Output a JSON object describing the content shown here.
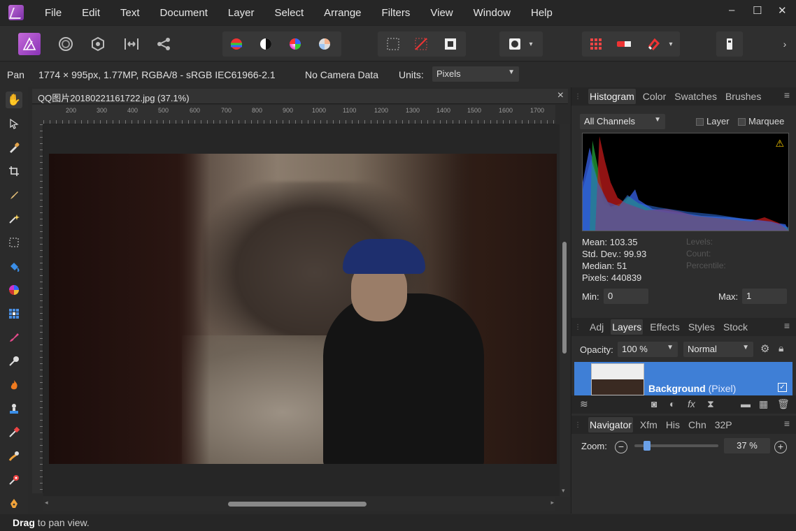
{
  "menu": {
    "items": [
      "File",
      "Edit",
      "Text",
      "Document",
      "Layer",
      "Select",
      "Arrange",
      "Filters",
      "View",
      "Window",
      "Help"
    ],
    "window_controls": [
      "–",
      "☐",
      "✕"
    ]
  },
  "toolbar": {
    "icons": [
      "persona-photo-icon",
      "persona-liquify-icon",
      "persona-develop-icon",
      "persona-tonemap-icon",
      "persona-export-icon",
      "auto-levels-icon",
      "auto-contrast-icon",
      "auto-colors-icon",
      "auto-white-balance-icon",
      "marquee-icon",
      "deselect-icon",
      "invert-selection-icon",
      "quickmask-icon",
      "snapping-grid-icon",
      "snapping-toggle-icon",
      "snapping-magnet-icon",
      "assistant-icon",
      "more-icon"
    ]
  },
  "context": {
    "tool": "Pan",
    "doc_info": "1774 × 995px, 1.77MP, RGBA/8 - sRGB IEC61966-2.1",
    "camera": "No Camera Data",
    "units_label": "Units:",
    "units_value": "Pixels"
  },
  "document": {
    "tab_title": "QQ图片20180221161722.jpg (37.1%)",
    "close": "×",
    "ruler_h": [
      "200",
      "300",
      "400",
      "500",
      "600",
      "700",
      "800",
      "900",
      "1000",
      "1100",
      "1200",
      "1300",
      "1400",
      "1500",
      "1600",
      "1700"
    ]
  },
  "panels": {
    "top_tabs": [
      "Histogram",
      "Color",
      "Swatches",
      "Brushes"
    ],
    "channels": "All Channels",
    "layer_opt": "Layer",
    "marquee_opt": "Marquee",
    "stats": {
      "mean": "Mean: 103.35",
      "std": "Std. Dev.: 99.93",
      "median": "Median: 51",
      "pixels": "Pixels: 440839"
    },
    "ghost": [
      "Levels:",
      "Count:",
      "Percentile:"
    ],
    "min_label": "Min:",
    "min_value": "0",
    "max_label": "Max:",
    "max_value": "1",
    "mid_tabs": [
      "Adj",
      "Layers",
      "Effects",
      "Styles",
      "Stock"
    ],
    "opacity_label": "Opacity:",
    "opacity_value": "100 %",
    "blend_mode": "Normal",
    "layer": {
      "name": "Background",
      "kind": "(Pixel)",
      "check": "✓"
    },
    "bottom_tabs": [
      "Navigator",
      "Xfm",
      "His",
      "Chn",
      "32P"
    ],
    "zoom_label": "Zoom:",
    "zoom_value": "37 %",
    "zoom_fraction": 0.12
  },
  "status": {
    "bold": "Drag",
    "rest": " to pan view."
  },
  "colors": {
    "accent": "#3f7fd6",
    "persona": "#a34cc9"
  }
}
